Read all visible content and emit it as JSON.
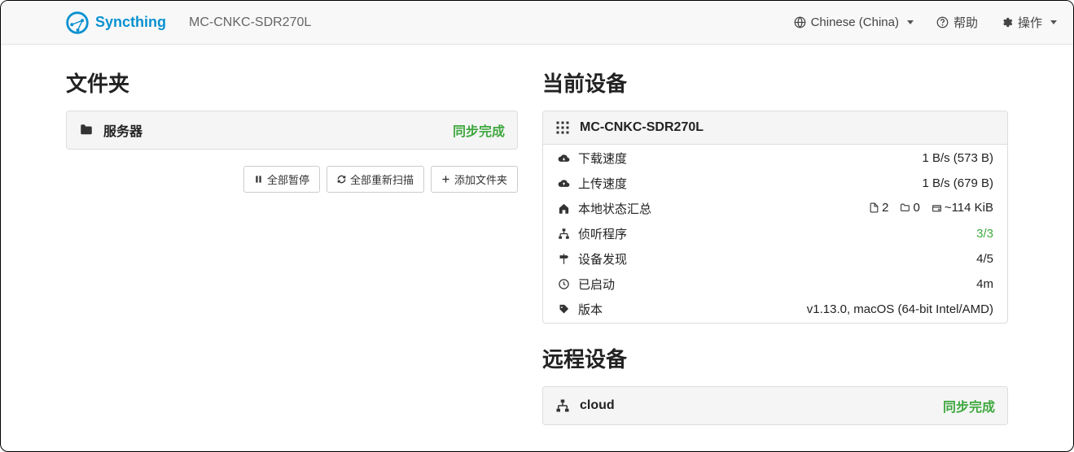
{
  "brand": "Syncthing",
  "nav": {
    "device_name": "MC-CNKC-SDR270L",
    "language": "Chinese (China)",
    "help": "帮助",
    "actions": "操作"
  },
  "folders": {
    "heading": "文件夹",
    "items": [
      {
        "name": "服务器",
        "status": "同步完成"
      }
    ],
    "buttons": {
      "pause_all": "全部暂停",
      "rescan_all": "全部重新扫描",
      "add_folder": "添加文件夹"
    }
  },
  "this_device": {
    "heading": "当前设备",
    "name": "MC-CNKC-SDR270L",
    "rows": {
      "download_label": "下载速度",
      "download_value": "1 B/s (573 B)",
      "upload_label": "上传速度",
      "upload_value": "1 B/s (679 B)",
      "local_state_label": "本地状态汇总",
      "local_files": "2",
      "local_dirs": "0",
      "local_size": "~114 KiB",
      "listeners_label": "侦听程序",
      "listeners_value": "3/3",
      "discovery_label": "设备发现",
      "discovery_value": "4/5",
      "uptime_label": "已启动",
      "uptime_value": "4m",
      "version_label": "版本",
      "version_value": "v1.13.0, macOS (64-bit Intel/AMD)"
    }
  },
  "remote_devices": {
    "heading": "远程设备",
    "items": [
      {
        "name": "cloud",
        "status": "同步完成"
      }
    ]
  }
}
